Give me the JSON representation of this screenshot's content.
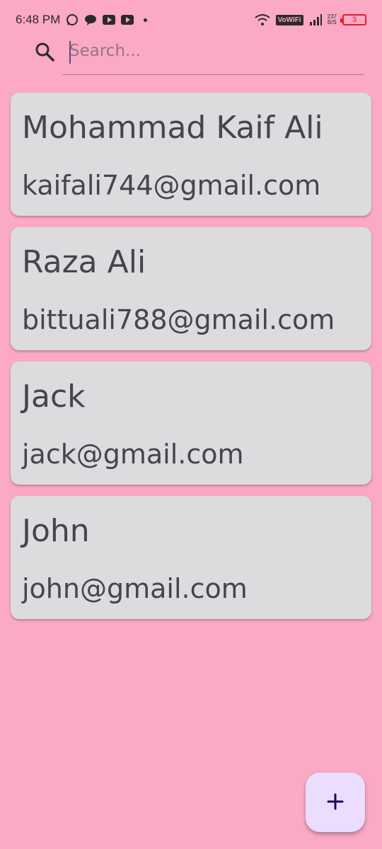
{
  "status_bar": {
    "time": "6:48 PM",
    "vowifi": "VoWiFi",
    "speed_value": "237",
    "speed_unit": "B/S",
    "battery": "3"
  },
  "search": {
    "placeholder": "Search...",
    "value": ""
  },
  "contacts": [
    {
      "name": "Mohammad Kaif Ali",
      "email": "kaifali744@gmail.com"
    },
    {
      "name": "Raza Ali",
      "email": "bittuali788@gmail.com"
    },
    {
      "name": "Jack",
      "email": "jack@gmail.com"
    },
    {
      "name": "John",
      "email": "john@gmail.com"
    }
  ],
  "fab": {
    "icon": "plus-icon"
  },
  "colors": {
    "background": "#fba9c5",
    "card": "#dcdbdd",
    "fab": "#eaddff",
    "text": "#46444c"
  }
}
